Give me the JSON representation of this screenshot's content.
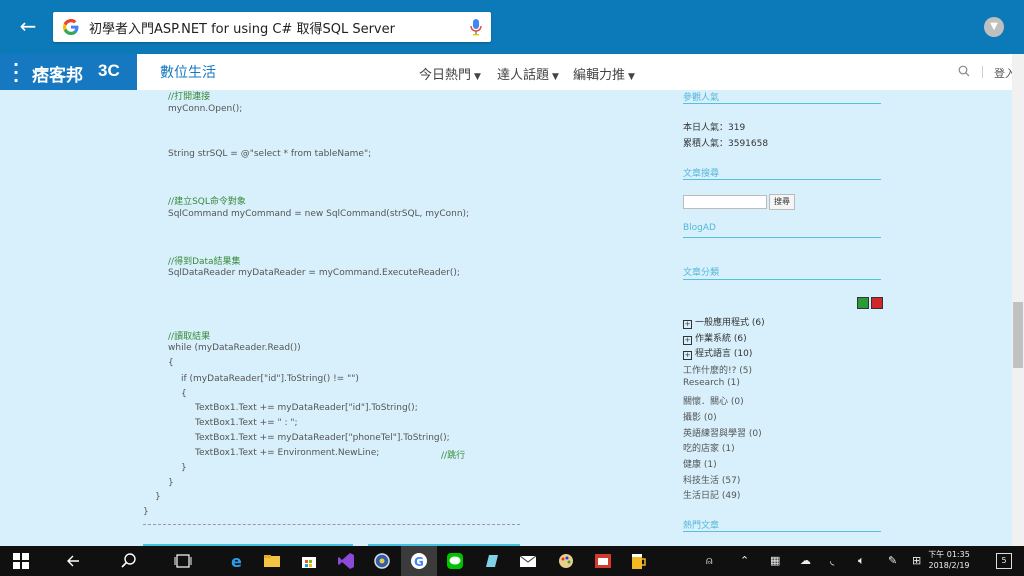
{
  "browser": {
    "search_query": "初學者入門ASP.NET for using C# 取得SQL Server"
  },
  "site": {
    "logo_name": "痞客邦",
    "logo_tag": "3C",
    "channel": "數位生活",
    "nav": [
      "今日熱門",
      "達人話題",
      "編輯力推"
    ],
    "login": "登入"
  },
  "code_lines": [
    {
      "text": "//打開連接",
      "kind": "comment"
    },
    {
      "text": "myConn.Open();",
      "kind": "code"
    },
    {
      "text": "String strSQL = @\"select * from tableName\";",
      "kind": "code"
    },
    {
      "text": "//建立SQL命令對象",
      "kind": "comment"
    },
    {
      "text": "SqlCommand myCommand = new SqlCommand(strSQL, myConn);",
      "kind": "code"
    },
    {
      "text": "//得到Data結果集",
      "kind": "comment"
    },
    {
      "text": "SqlDataReader myDataReader = myCommand.ExecuteReader();",
      "kind": "code"
    },
    {
      "text": "//讀取結果",
      "kind": "comment"
    },
    {
      "text": "while (myDataReader.Read())",
      "kind": "code"
    },
    {
      "text": "{",
      "kind": "code"
    },
    {
      "text": "if (myDataReader[\"id\"].ToString() != \"\")",
      "kind": "code"
    },
    {
      "text": "{",
      "kind": "code"
    },
    {
      "text": "TextBox1.Text += myDataReader[\"id\"].ToString();",
      "kind": "code"
    },
    {
      "text": "TextBox1.Text += \" : \";",
      "kind": "code"
    },
    {
      "text": "TextBox1.Text += myDataReader[\"phoneTel\"].ToString();",
      "kind": "code"
    },
    {
      "text": "TextBox1.Text += Environment.NewLine;",
      "kind": "code"
    },
    {
      "text": "//跳行",
      "kind": "comment"
    },
    {
      "text": "}",
      "kind": "code"
    },
    {
      "text": "}",
      "kind": "code"
    },
    {
      "text": "}",
      "kind": "code"
    },
    {
      "text": "}",
      "kind": "code"
    }
  ],
  "sidebar": {
    "visitors_title": "參觀人氣",
    "today_label": "本日人氣：319",
    "total_label": "累積人氣：3591658",
    "search_title": "文章搜尋",
    "search_button": "搜尋",
    "blogad_title": "BlogAD",
    "category_title": "文章分類",
    "categories_expandable": [
      "一般應用程式 (6)",
      "作業系統 (6)",
      "程式語言 (10)"
    ],
    "categories": [
      "工作什麼的!? (5)",
      "Research (1)",
      "關懷．關心 (0)",
      "攝影 (0)",
      "英語練習與學習 (0)",
      "吃的店家 (1)",
      "健康 (1)",
      "科技生活 (57)",
      "生活日記 (49)"
    ],
    "hot_title": "熱門文章"
  },
  "taskbar": {
    "time": "下午 01:35",
    "date": "2018/2/19",
    "notifications": "5"
  }
}
